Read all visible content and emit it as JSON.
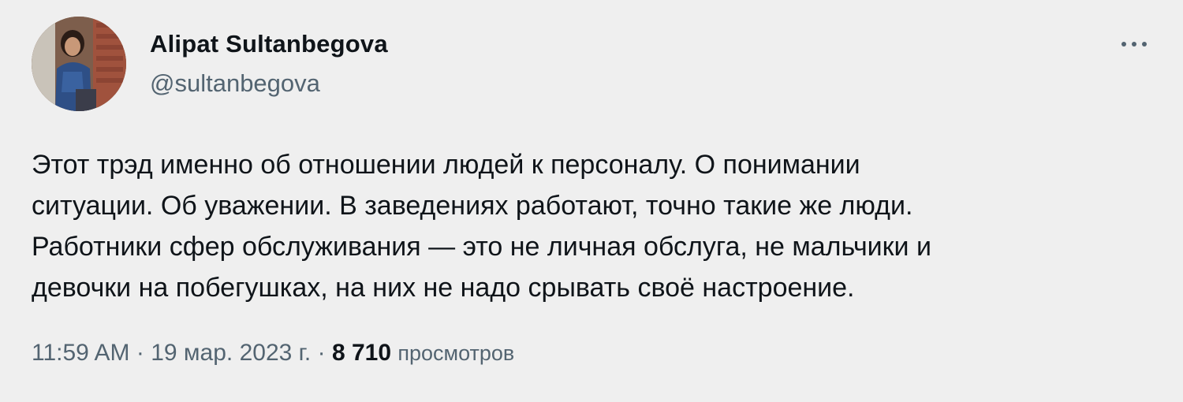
{
  "author": {
    "display_name": "Alipat Sultanbegova",
    "handle": "@sultanbegova"
  },
  "tweet": {
    "text_lines": [
      "Этот трэд именно об отношении людей к персоналу. О понимании",
      "ситуации. Об уважении. В заведениях работают, точно такие же люди.",
      "Работники сфер обслуживания — это не личная обслуга, не мальчики и",
      "девочки на побегушках, на них не надо срывать своё настроение."
    ]
  },
  "meta": {
    "time": "11:59 AM",
    "separator": " · ",
    "date": "19 мар. 2023 г.",
    "views_count": "8 710",
    "views_label": "просмотров"
  },
  "icons": {
    "more": "more-horizontal-icon"
  },
  "colors": {
    "background": "#efefef",
    "text_primary": "#0f1419",
    "text_secondary": "#536471"
  }
}
